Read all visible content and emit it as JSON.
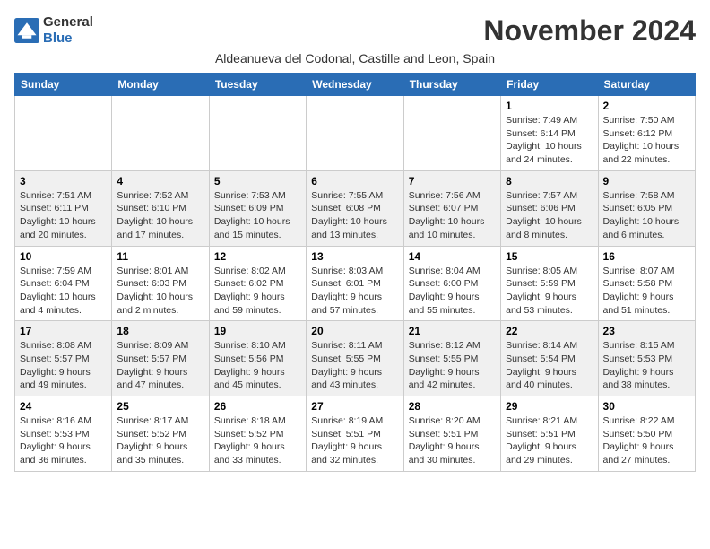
{
  "header": {
    "logo_general": "General",
    "logo_blue": "Blue",
    "month_title": "November 2024",
    "location": "Aldeanueva del Codonal, Castille and Leon, Spain"
  },
  "weekdays": [
    "Sunday",
    "Monday",
    "Tuesday",
    "Wednesday",
    "Thursday",
    "Friday",
    "Saturday"
  ],
  "weeks": [
    [
      {
        "day": "",
        "info": ""
      },
      {
        "day": "",
        "info": ""
      },
      {
        "day": "",
        "info": ""
      },
      {
        "day": "",
        "info": ""
      },
      {
        "day": "",
        "info": ""
      },
      {
        "day": "1",
        "info": "Sunrise: 7:49 AM\nSunset: 6:14 PM\nDaylight: 10 hours and 24 minutes."
      },
      {
        "day": "2",
        "info": "Sunrise: 7:50 AM\nSunset: 6:12 PM\nDaylight: 10 hours and 22 minutes."
      }
    ],
    [
      {
        "day": "3",
        "info": "Sunrise: 7:51 AM\nSunset: 6:11 PM\nDaylight: 10 hours and 20 minutes."
      },
      {
        "day": "4",
        "info": "Sunrise: 7:52 AM\nSunset: 6:10 PM\nDaylight: 10 hours and 17 minutes."
      },
      {
        "day": "5",
        "info": "Sunrise: 7:53 AM\nSunset: 6:09 PM\nDaylight: 10 hours and 15 minutes."
      },
      {
        "day": "6",
        "info": "Sunrise: 7:55 AM\nSunset: 6:08 PM\nDaylight: 10 hours and 13 minutes."
      },
      {
        "day": "7",
        "info": "Sunrise: 7:56 AM\nSunset: 6:07 PM\nDaylight: 10 hours and 10 minutes."
      },
      {
        "day": "8",
        "info": "Sunrise: 7:57 AM\nSunset: 6:06 PM\nDaylight: 10 hours and 8 minutes."
      },
      {
        "day": "9",
        "info": "Sunrise: 7:58 AM\nSunset: 6:05 PM\nDaylight: 10 hours and 6 minutes."
      }
    ],
    [
      {
        "day": "10",
        "info": "Sunrise: 7:59 AM\nSunset: 6:04 PM\nDaylight: 10 hours and 4 minutes."
      },
      {
        "day": "11",
        "info": "Sunrise: 8:01 AM\nSunset: 6:03 PM\nDaylight: 10 hours and 2 minutes."
      },
      {
        "day": "12",
        "info": "Sunrise: 8:02 AM\nSunset: 6:02 PM\nDaylight: 9 hours and 59 minutes."
      },
      {
        "day": "13",
        "info": "Sunrise: 8:03 AM\nSunset: 6:01 PM\nDaylight: 9 hours and 57 minutes."
      },
      {
        "day": "14",
        "info": "Sunrise: 8:04 AM\nSunset: 6:00 PM\nDaylight: 9 hours and 55 minutes."
      },
      {
        "day": "15",
        "info": "Sunrise: 8:05 AM\nSunset: 5:59 PM\nDaylight: 9 hours and 53 minutes."
      },
      {
        "day": "16",
        "info": "Sunrise: 8:07 AM\nSunset: 5:58 PM\nDaylight: 9 hours and 51 minutes."
      }
    ],
    [
      {
        "day": "17",
        "info": "Sunrise: 8:08 AM\nSunset: 5:57 PM\nDaylight: 9 hours and 49 minutes."
      },
      {
        "day": "18",
        "info": "Sunrise: 8:09 AM\nSunset: 5:57 PM\nDaylight: 9 hours and 47 minutes."
      },
      {
        "day": "19",
        "info": "Sunrise: 8:10 AM\nSunset: 5:56 PM\nDaylight: 9 hours and 45 minutes."
      },
      {
        "day": "20",
        "info": "Sunrise: 8:11 AM\nSunset: 5:55 PM\nDaylight: 9 hours and 43 minutes."
      },
      {
        "day": "21",
        "info": "Sunrise: 8:12 AM\nSunset: 5:55 PM\nDaylight: 9 hours and 42 minutes."
      },
      {
        "day": "22",
        "info": "Sunrise: 8:14 AM\nSunset: 5:54 PM\nDaylight: 9 hours and 40 minutes."
      },
      {
        "day": "23",
        "info": "Sunrise: 8:15 AM\nSunset: 5:53 PM\nDaylight: 9 hours and 38 minutes."
      }
    ],
    [
      {
        "day": "24",
        "info": "Sunrise: 8:16 AM\nSunset: 5:53 PM\nDaylight: 9 hours and 36 minutes."
      },
      {
        "day": "25",
        "info": "Sunrise: 8:17 AM\nSunset: 5:52 PM\nDaylight: 9 hours and 35 minutes."
      },
      {
        "day": "26",
        "info": "Sunrise: 8:18 AM\nSunset: 5:52 PM\nDaylight: 9 hours and 33 minutes."
      },
      {
        "day": "27",
        "info": "Sunrise: 8:19 AM\nSunset: 5:51 PM\nDaylight: 9 hours and 32 minutes."
      },
      {
        "day": "28",
        "info": "Sunrise: 8:20 AM\nSunset: 5:51 PM\nDaylight: 9 hours and 30 minutes."
      },
      {
        "day": "29",
        "info": "Sunrise: 8:21 AM\nSunset: 5:51 PM\nDaylight: 9 hours and 29 minutes."
      },
      {
        "day": "30",
        "info": "Sunrise: 8:22 AM\nSunset: 5:50 PM\nDaylight: 9 hours and 27 minutes."
      }
    ]
  ]
}
